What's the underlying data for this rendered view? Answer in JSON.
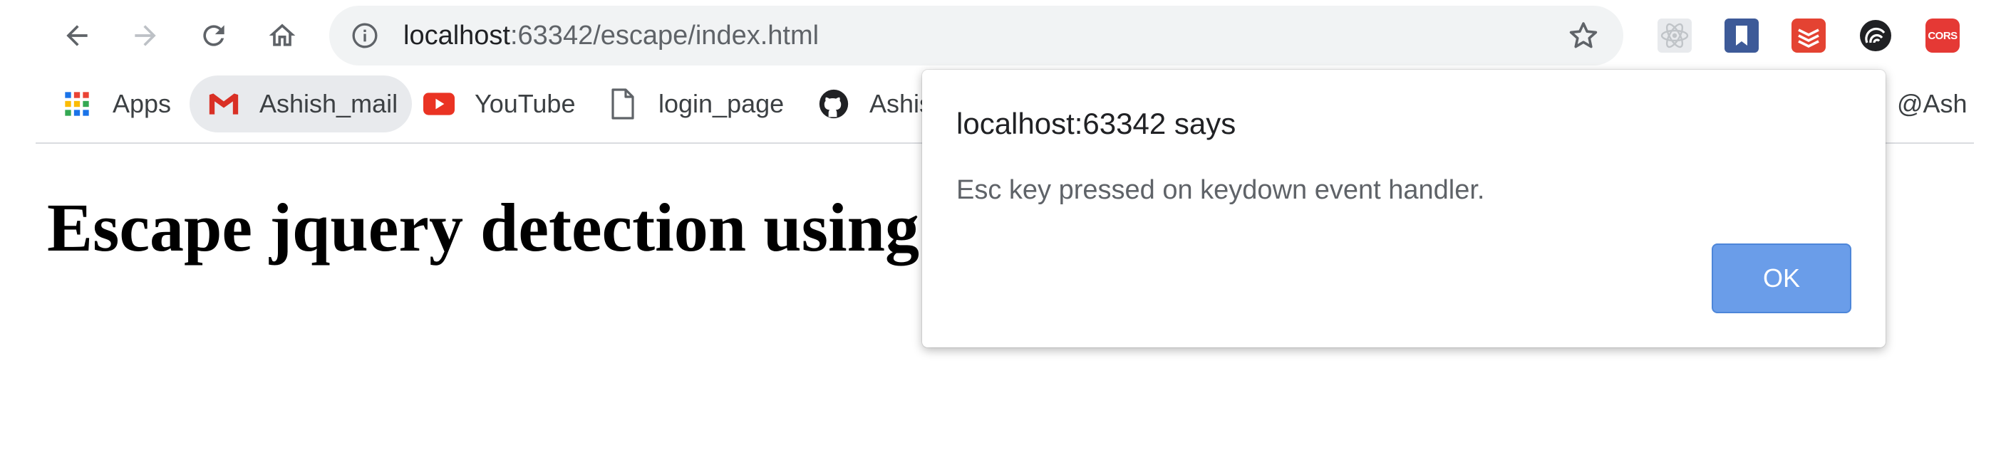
{
  "browser": {
    "url_host": "localhost",
    "url_rest": ":63342/escape/index.html"
  },
  "bookmarks": [
    {
      "label": "Apps",
      "icon": "apps-grid-icon"
    },
    {
      "label": "Ashish_mail",
      "icon": "gmail-icon"
    },
    {
      "label": "YouTube",
      "icon": "youtube-icon"
    },
    {
      "label": "login_page",
      "icon": "page-icon"
    },
    {
      "label": "Ashis",
      "icon": "github-icon"
    },
    {
      "label": "@Ash",
      "icon": "bookmark-icon"
    }
  ],
  "extensions": [
    "react-devtools-icon",
    "bookmark-ext-icon",
    "todoist-icon",
    "wave-ext-icon",
    "cors-icon"
  ],
  "extension_text": {
    "cors": "CORS"
  },
  "page": {
    "heading": "Escape jquery detection using"
  },
  "dialog": {
    "title": "localhost:63342 says",
    "message": "Esc key pressed on keydown event handler.",
    "ok_label": "OK"
  },
  "colors": {
    "ok_button": "#6a9de9",
    "omnibox_bg": "#f1f3f4",
    "gmail_red": "#d93025",
    "youtube_red": "#ea3323",
    "cors_red": "#e53935"
  }
}
